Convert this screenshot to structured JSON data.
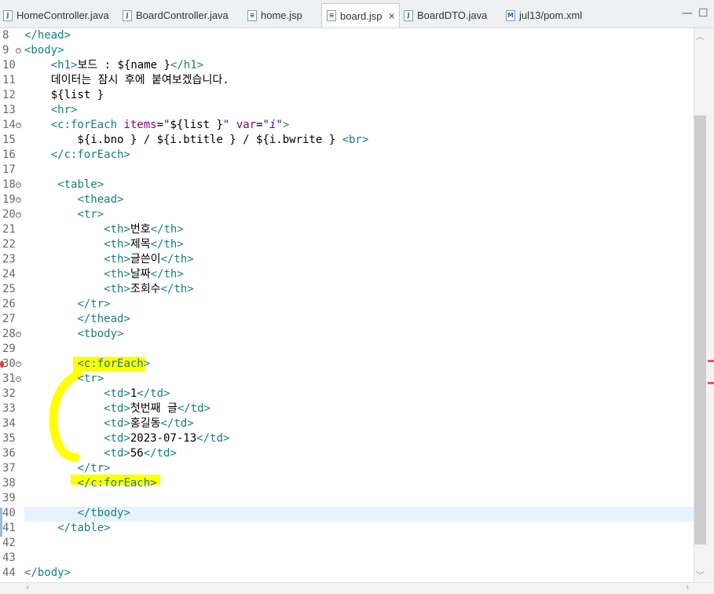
{
  "tabs": [
    {
      "label": "HomeController.java",
      "icon": "java-file-icon",
      "active": false
    },
    {
      "label": "BoardController.java",
      "icon": "java-file-icon",
      "active": false
    },
    {
      "label": "home.jsp",
      "icon": "jsp-file-icon",
      "active": false
    },
    {
      "label": "board.jsp",
      "icon": "jsp-file-icon",
      "active": true
    },
    {
      "label": "BoardDTO.java",
      "icon": "java-file-icon",
      "active": false
    },
    {
      "label": "jul13/pom.xml",
      "icon": "maven-file-icon",
      "active": false
    }
  ],
  "close_glyph": "×",
  "window": {
    "minimize": "—",
    "maximize": "☐"
  },
  "colors": {
    "tag": "#17807e",
    "attr": "#7f007f",
    "string": "#2a00ff",
    "highlight": "#ffff00",
    "current_line": "#e8f2fe"
  },
  "lines": [
    {
      "n": "8",
      "fold": false,
      "segs": [
        [
          "tag",
          "</head>"
        ]
      ]
    },
    {
      "n": "9",
      "fold": true,
      "segs": [
        [
          "tag",
          "<body>"
        ]
      ]
    },
    {
      "n": "10",
      "fold": false,
      "segs": [
        [
          "el",
          "    "
        ],
        [
          "tag",
          "<h1>"
        ],
        [
          "el",
          "보드 : ${name }"
        ],
        [
          "tag",
          "</h1>"
        ]
      ]
    },
    {
      "n": "11",
      "fold": false,
      "segs": [
        [
          "el",
          "    데이터는 잠시 후에 붙여보겠습니다."
        ]
      ]
    },
    {
      "n": "12",
      "fold": false,
      "segs": [
        [
          "el",
          "    ${list }"
        ]
      ]
    },
    {
      "n": "13",
      "fold": false,
      "segs": [
        [
          "el",
          "    "
        ],
        [
          "tag",
          "<hr>"
        ]
      ]
    },
    {
      "n": "14",
      "fold": true,
      "segs": [
        [
          "el",
          "    "
        ],
        [
          "tag",
          "<c:forEach "
        ],
        [
          "attr",
          "items"
        ],
        [
          "el",
          "="
        ],
        [
          "str",
          "\""
        ],
        [
          "el",
          "${list }"
        ],
        [
          "str",
          "\""
        ],
        [
          "el",
          " "
        ],
        [
          "attr",
          "var"
        ],
        [
          "el",
          "="
        ],
        [
          "str",
          "\"i\""
        ],
        [
          "tag",
          ">"
        ]
      ]
    },
    {
      "n": "15",
      "fold": false,
      "segs": [
        [
          "el",
          "        ${i.bno } / ${i.btitle } / ${i.bwrite } "
        ],
        [
          "tag",
          "<br>"
        ]
      ]
    },
    {
      "n": "16",
      "fold": false,
      "segs": [
        [
          "el",
          "    "
        ],
        [
          "tag",
          "</c:forEach>"
        ]
      ]
    },
    {
      "n": "17",
      "fold": false,
      "segs": []
    },
    {
      "n": "18",
      "fold": true,
      "segs": [
        [
          "el",
          "     "
        ],
        [
          "tag",
          "<table>"
        ]
      ]
    },
    {
      "n": "19",
      "fold": true,
      "segs": [
        [
          "el",
          "        "
        ],
        [
          "tag",
          "<thead>"
        ]
      ]
    },
    {
      "n": "20",
      "fold": true,
      "segs": [
        [
          "el",
          "        "
        ],
        [
          "tag",
          "<tr>"
        ]
      ]
    },
    {
      "n": "21",
      "fold": false,
      "segs": [
        [
          "el",
          "            "
        ],
        [
          "tag",
          "<th>"
        ],
        [
          "el",
          "번호"
        ],
        [
          "tag",
          "</th>"
        ]
      ]
    },
    {
      "n": "22",
      "fold": false,
      "segs": [
        [
          "el",
          "            "
        ],
        [
          "tag",
          "<th>"
        ],
        [
          "el",
          "제목"
        ],
        [
          "tag",
          "</th>"
        ]
      ]
    },
    {
      "n": "23",
      "fold": false,
      "segs": [
        [
          "el",
          "            "
        ],
        [
          "tag",
          "<th>"
        ],
        [
          "el",
          "글쓴이"
        ],
        [
          "tag",
          "</th>"
        ]
      ]
    },
    {
      "n": "24",
      "fold": false,
      "segs": [
        [
          "el",
          "            "
        ],
        [
          "tag",
          "<th>"
        ],
        [
          "el",
          "날짜"
        ],
        [
          "tag",
          "</th>"
        ]
      ]
    },
    {
      "n": "25",
      "fold": false,
      "segs": [
        [
          "el",
          "            "
        ],
        [
          "tag",
          "<th>"
        ],
        [
          "el",
          "조회수"
        ],
        [
          "tag",
          "</th>"
        ]
      ]
    },
    {
      "n": "26",
      "fold": false,
      "segs": [
        [
          "el",
          "        "
        ],
        [
          "tag",
          "</tr>"
        ]
      ]
    },
    {
      "n": "27",
      "fold": false,
      "segs": [
        [
          "el",
          "        "
        ],
        [
          "tag",
          "</thead>"
        ]
      ]
    },
    {
      "n": "28",
      "fold": true,
      "segs": [
        [
          "el",
          "        "
        ],
        [
          "tag",
          "<tbody>"
        ]
      ]
    },
    {
      "n": "29",
      "fold": false,
      "segs": []
    },
    {
      "n": "30",
      "fold": true,
      "segs": [
        [
          "el",
          "        "
        ],
        [
          "tag",
          "<c:forEach>"
        ]
      ]
    },
    {
      "n": "31",
      "fold": true,
      "segs": [
        [
          "el",
          "        "
        ],
        [
          "tag",
          "<tr>"
        ]
      ]
    },
    {
      "n": "32",
      "fold": false,
      "segs": [
        [
          "el",
          "            "
        ],
        [
          "tag",
          "<td>"
        ],
        [
          "el",
          "1"
        ],
        [
          "tag",
          "</td>"
        ]
      ]
    },
    {
      "n": "33",
      "fold": false,
      "segs": [
        [
          "el",
          "            "
        ],
        [
          "tag",
          "<td>"
        ],
        [
          "el",
          "첫번째 글"
        ],
        [
          "tag",
          "</td>"
        ]
      ]
    },
    {
      "n": "34",
      "fold": false,
      "segs": [
        [
          "el",
          "            "
        ],
        [
          "tag",
          "<td>"
        ],
        [
          "el",
          "홍길동"
        ],
        [
          "tag",
          "</td>"
        ]
      ]
    },
    {
      "n": "35",
      "fold": false,
      "segs": [
        [
          "el",
          "            "
        ],
        [
          "tag",
          "<td>"
        ],
        [
          "el",
          "2023-07-13"
        ],
        [
          "tag",
          "</td>"
        ]
      ]
    },
    {
      "n": "36",
      "fold": false,
      "segs": [
        [
          "el",
          "            "
        ],
        [
          "tag",
          "<td>"
        ],
        [
          "el",
          "56"
        ],
        [
          "tag",
          "</td>"
        ]
      ]
    },
    {
      "n": "37",
      "fold": false,
      "segs": [
        [
          "el",
          "        "
        ],
        [
          "tag",
          "</tr>"
        ]
      ]
    },
    {
      "n": "38",
      "fold": false,
      "segs": [
        [
          "el",
          "        "
        ],
        [
          "tag",
          "</c:forEach>"
        ]
      ]
    },
    {
      "n": "39",
      "fold": false,
      "segs": []
    },
    {
      "n": "40",
      "fold": false,
      "segs": [
        [
          "el",
          "        "
        ],
        [
          "tag",
          "</tbody>"
        ]
      ]
    },
    {
      "n": "41",
      "fold": false,
      "segs": [
        [
          "el",
          "     "
        ],
        [
          "tag",
          "</table>"
        ]
      ]
    },
    {
      "n": "42",
      "fold": false,
      "segs": []
    },
    {
      "n": "43",
      "fold": false,
      "segs": []
    },
    {
      "n": "44",
      "fold": false,
      "segs": [
        [
          "tag",
          "</body>"
        ]
      ]
    }
  ]
}
